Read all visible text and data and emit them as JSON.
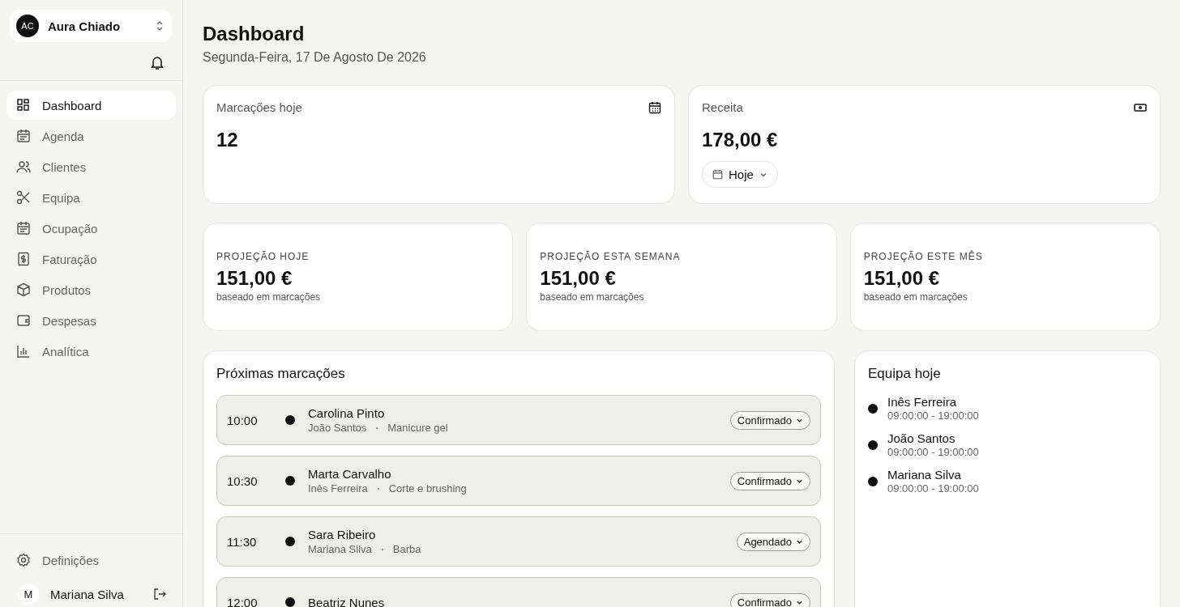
{
  "sidebar": {
    "workspace": {
      "initials": "AC",
      "name": "Aura Chiado"
    },
    "items": [
      {
        "label": "Dashboard",
        "selected": true
      },
      {
        "label": "Agenda",
        "selected": false
      },
      {
        "label": "Clientes",
        "selected": false
      },
      {
        "label": "Equipa",
        "selected": false
      },
      {
        "label": "Ocupação",
        "selected": false
      },
      {
        "label": "Faturação",
        "selected": false
      },
      {
        "label": "Produtos",
        "selected": false
      },
      {
        "label": "Despesas",
        "selected": false
      },
      {
        "label": "Analítica",
        "selected": false
      }
    ],
    "settings": "Definições",
    "user": {
      "initial": "M",
      "name": "Mariana Silva"
    }
  },
  "header": {
    "title": "Dashboard",
    "date": "Segunda-Feira, 17 De Agosto De 2026"
  },
  "stats": [
    {
      "label": "Marcações hoje",
      "value": "12"
    },
    {
      "label": "Receita",
      "value": "178,00 €",
      "period": "Hoje"
    }
  ],
  "projections": [
    {
      "label": "PROJEÇÃO HOJE",
      "value": "151,00 €",
      "note": "baseado em marcações"
    },
    {
      "label": "PROJEÇÃO ESTA SEMANA",
      "value": "151,00 €",
      "note": "baseado em marcações"
    },
    {
      "label": "PROJEÇÃO ESTE MÊS",
      "value": "151,00 €",
      "note": "baseado em marcações"
    }
  ],
  "appointments": {
    "title": "Próximas marcações",
    "rows": [
      {
        "time": "10:00",
        "client": "Carolina Pinto",
        "staff": "João Santos",
        "service": "Manicure gel",
        "status": "Confirmado"
      },
      {
        "time": "10:30",
        "client": "Marta Carvalho",
        "staff": "Inês Ferreira",
        "service": "Corte e brushing",
        "status": "Confirmado"
      },
      {
        "time": "11:30",
        "client": "Sara Ribeiro",
        "staff": "Mariana Silva",
        "service": "Barba",
        "status": "Agendado"
      },
      {
        "time": "12:00",
        "client": "Beatriz Nunes",
        "status": "Confirmado"
      }
    ]
  },
  "team": {
    "title": "Equipa hoje",
    "members": [
      {
        "name": "Inês Ferreira",
        "hours": "09:00:00 - 19:00:00"
      },
      {
        "name": "João Santos",
        "hours": "09:00:00 - 19:00:00"
      },
      {
        "name": "Mariana Silva",
        "hours": "09:00:00 - 19:00:00"
      }
    ]
  }
}
